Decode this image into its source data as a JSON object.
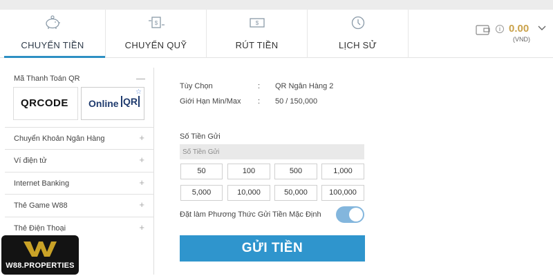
{
  "tabs": [
    {
      "label": "CHUYỂN TIỀN",
      "icon": "piggy-bank-icon",
      "active": true
    },
    {
      "label": "CHUYỂN QUỸ",
      "icon": "transfer-funds-icon",
      "active": false
    },
    {
      "label": "RÚT TIỀN",
      "icon": "withdraw-cash-icon",
      "active": false
    },
    {
      "label": "LỊCH SỬ",
      "icon": "history-clock-icon",
      "active": false
    }
  ],
  "wallet": {
    "balance": "0.00",
    "currency": "(VND)",
    "info": "i"
  },
  "sidebar": {
    "qr_section": {
      "title": "Mã Thanh Toán QR",
      "collapse": "—",
      "option_a": "QRCODE",
      "option_b_text": "Online",
      "option_b_qr": "QR"
    },
    "items": [
      {
        "label": "Chuyển Khoản Ngân Hàng"
      },
      {
        "label": "Ví điện tử"
      },
      {
        "label": "Internet Banking"
      },
      {
        "label": "Thẻ Game W88"
      },
      {
        "label": "Thẻ Điện Thoại"
      }
    ],
    "expand_symbol": "+"
  },
  "details": {
    "option_label": "Tùy Chọn",
    "option_value": "QR Ngân Hàng 2",
    "limit_label": "Giới Hạn Min/Max",
    "limit_value": "50 / 150,000",
    "separator": ":"
  },
  "deposit": {
    "amount_label": "Số Tiền Gửi",
    "amount_placeholder": "Số Tiền Gửi",
    "quick_amounts": [
      "50",
      "100",
      "500",
      "1,000",
      "5,000",
      "10,000",
      "50,000",
      "100,000"
    ],
    "default_label": "Đặt làm Phương Thức Gửi Tiền Mặc Định",
    "default_enabled": true,
    "submit_label": "GỬI TIỀN"
  },
  "brand": {
    "name": "W88.PROPERTIES"
  },
  "colors": {
    "accent": "#2f95cd",
    "balance": "#caa24a",
    "toggle": "#83b6dd",
    "logo_gold": "#c9a227"
  }
}
